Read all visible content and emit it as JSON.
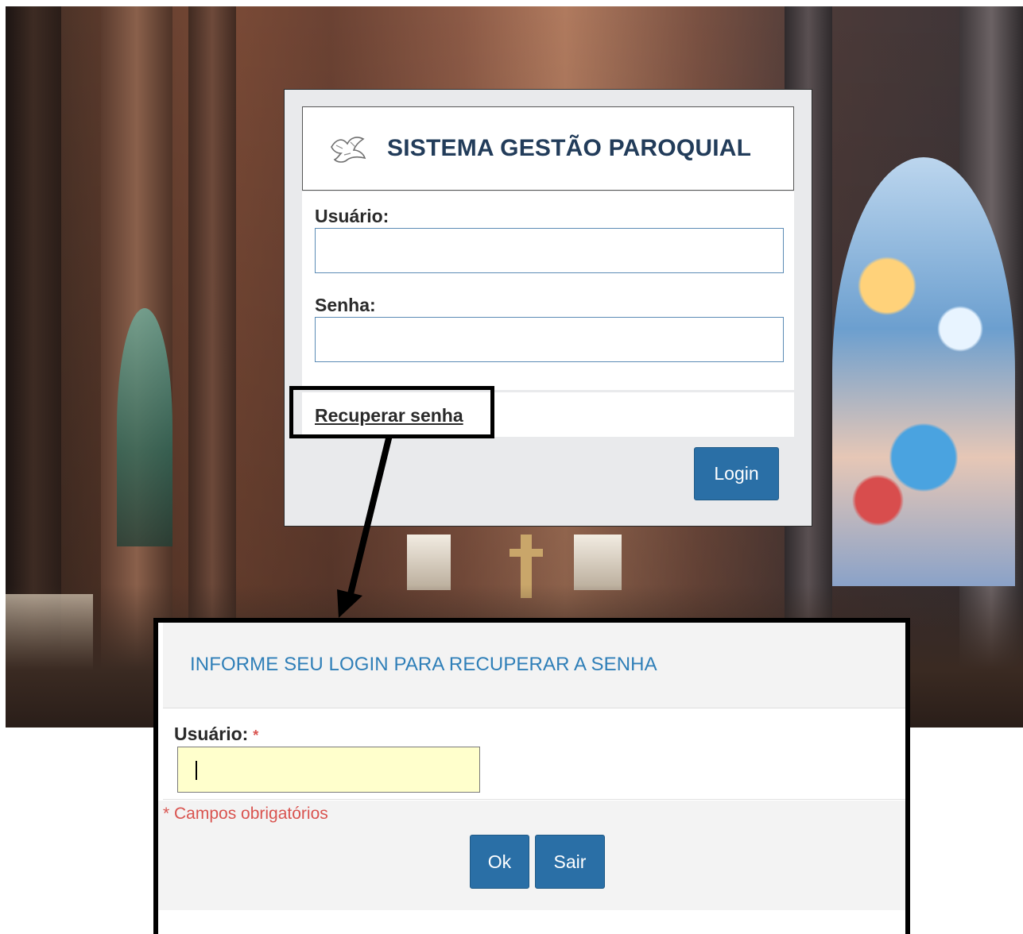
{
  "login": {
    "title": "SISTEMA GESTÃO PAROQUIAL",
    "username_label": "Usuário:",
    "username_value": "",
    "password_label": "Senha:",
    "password_value": "",
    "recover_link": "Recuperar senha",
    "login_button": "Login"
  },
  "recover_dialog": {
    "title": "INFORME SEU LOGIN PARA RECUPERAR A SENHA",
    "username_label": "Usuário:",
    "required_marker": "*",
    "username_value": "",
    "required_note": "* Campos obrigatórios",
    "ok_button": "Ok",
    "exit_button": "Sair"
  },
  "icons": {
    "logo": "dove-icon"
  },
  "colors": {
    "primary_button": "#2a6fa6",
    "dialog_title": "#2f7fb8",
    "required": "#d9534f",
    "input_highlight": "#ffffcc",
    "login_title": "#223c5a"
  }
}
